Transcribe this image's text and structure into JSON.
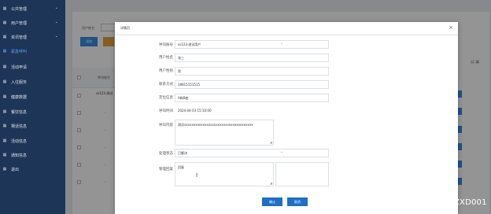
{
  "sidebar": {
    "items": [
      {
        "label": "公共管理",
        "icon": "grid-icon"
      },
      {
        "label": "用户管理",
        "icon": "grid-icon"
      },
      {
        "label": "资讯管理",
        "icon": "grid-icon"
      },
      {
        "label": "紧急呼叫",
        "icon": "grid-icon",
        "active": true
      },
      {
        "label": "活动申请",
        "icon": "grid-icon"
      },
      {
        "label": "入住服务",
        "icon": "grid-icon"
      },
      {
        "label": "健康数据",
        "icon": "grid-icon"
      },
      {
        "label": "餐饮信息",
        "icon": "grid-icon"
      },
      {
        "label": "場话信息",
        "icon": "grid-icon"
      },
      {
        "label": "活动信息",
        "icon": "grid-icon"
      },
      {
        "label": "通知信息",
        "icon": "grid-icon"
      },
      {
        "label": "退出",
        "icon": "grid-icon"
      }
    ]
  },
  "background": {
    "search_label": "用户姓名",
    "add_button": "添加",
    "col_header": "呼叫账号",
    "row_account": "ss123-测试",
    "dash": "-"
  },
  "dialog": {
    "title": "详情页",
    "close": "×",
    "fields": {
      "account_label": "呼叫账号",
      "account_value": "ss123-测试用户",
      "name_label": "用户姓名",
      "name_value": "张三",
      "gender_label": "用户性别",
      "gender_value": "男",
      "phone_label": "联系方式",
      "phone_value": "18815151515",
      "location_label": "定位信息",
      "location_value": "A栋B座",
      "time_label": "呼叫时间",
      "time_value": "2024-04-03 15:10:00",
      "content_label": "呼叫内容",
      "content_value": "测试xxxxxxxxxxxxxxxxxxxxxxxxxxxxxxxxxxxxx",
      "status_label": "处理状态",
      "status_value": "已解决",
      "reply_label": "管理回复",
      "reply_value": "回复"
    },
    "confirm": "确认",
    "cancel": "取消"
  },
  "watermark": "CSDN @MZ_ZXD001",
  "colors": {
    "sidebar_bg": "#1d3557",
    "primary": "#1f6fc5",
    "active": "#5aa6ff"
  }
}
